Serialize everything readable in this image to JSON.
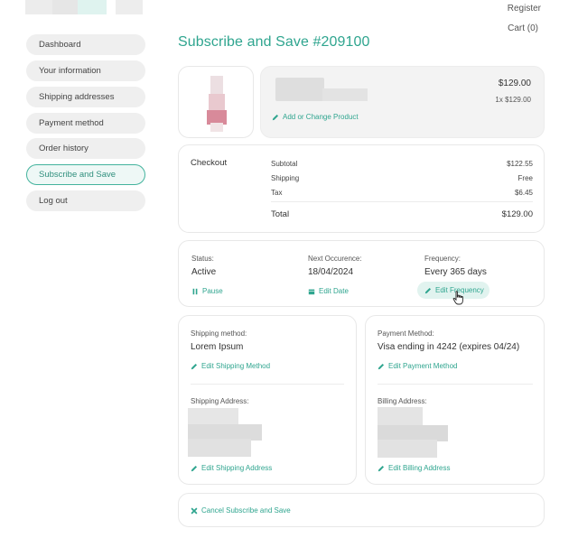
{
  "header": {
    "register": "Register",
    "cart": "Cart (0)"
  },
  "sidebar": {
    "items": [
      {
        "label": "Dashboard"
      },
      {
        "label": "Your information"
      },
      {
        "label": "Shipping addresses"
      },
      {
        "label": "Payment method"
      },
      {
        "label": "Order history"
      },
      {
        "label": "Subscribe and Save"
      },
      {
        "label": "Log out"
      }
    ],
    "active_index": 5
  },
  "page": {
    "title": "Subscribe and Save #209100"
  },
  "product": {
    "price": "$129.00",
    "qty_price": "1x $129.00",
    "change_link": "Add or Change Product"
  },
  "checkout": {
    "heading": "Checkout",
    "subtotal_label": "Subtotal",
    "subtotal_value": "$122.55",
    "shipping_label": "Shipping",
    "shipping_value": "Free",
    "tax_label": "Tax",
    "tax_value": "$6.45",
    "total_label": "Total",
    "total_value": "$129.00"
  },
  "status": {
    "status_label": "Status:",
    "status_value": "Active",
    "pause_link": "Pause",
    "next_label": "Next Occurence:",
    "next_value": "18/04/2024",
    "edit_date_link": "Edit Date",
    "frequency_label": "Frequency:",
    "frequency_value": "Every 365 days",
    "edit_frequency_link": "Edit Frequency"
  },
  "shipping": {
    "method_label": "Shipping method:",
    "method_value": "Lorem Ipsum",
    "edit_method_link": "Edit Shipping Method",
    "address_label": "Shipping Address:",
    "edit_address_link": "Edit Shipping Address"
  },
  "payment": {
    "method_label": "Payment Method:",
    "method_value": "Visa ending in 4242 (expires 04/24)",
    "edit_method_link": "Edit Payment Method",
    "billing_label": "Billing Address:",
    "edit_billing_link": "Edit Billing Address"
  },
  "cancel": {
    "link": "Cancel Subscribe and Save"
  },
  "colors": {
    "accent": "#2fa58f",
    "active_border": "#43b39d",
    "sidebar_bg": "#efefef",
    "card_border": "#e8e8e8"
  },
  "icons": [
    "pencil-icon",
    "pause-icon",
    "calendar-icon",
    "close-icon",
    "hand-cursor-icon"
  ]
}
